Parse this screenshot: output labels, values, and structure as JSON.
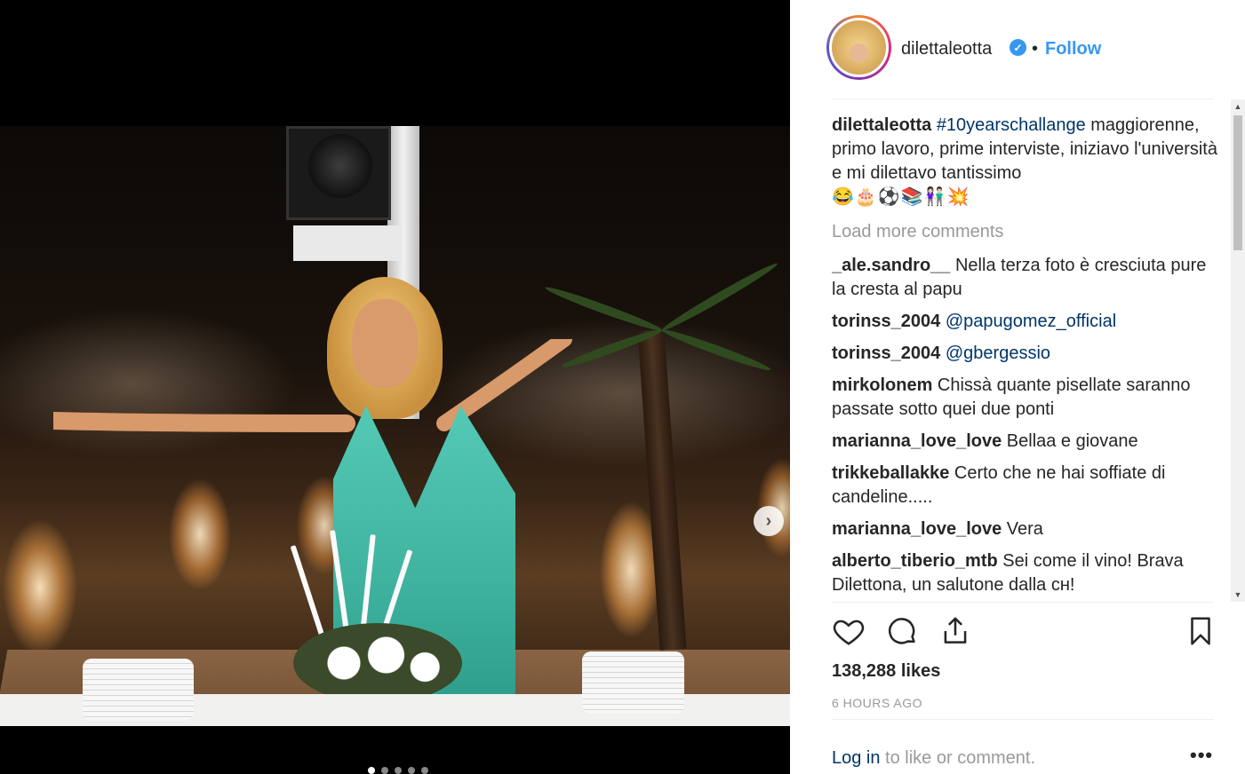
{
  "post": {
    "username": "dilettaleotta",
    "bullet": "•",
    "follow_label": "Follow",
    "caption": {
      "username": "dilettaleotta",
      "hashtag": "#10yearschallange",
      "text": " maggiorenne, primo lavoro, prime interviste, iniziavo l'università e mi dilettavo tantissimo",
      "emojis": "😂🎂⚽📚👫🏻💥"
    },
    "load_more_label": "Load more comments",
    "comments": [
      {
        "user": "_ale.sandro__",
        "mention": "",
        "text": "Nella terza foto è cresciuta pure la cresta al papu"
      },
      {
        "user": "torinss_2004",
        "mention": "@papugomez_official",
        "text": ""
      },
      {
        "user": "torinss_2004",
        "mention": "@gbergessio",
        "text": ""
      },
      {
        "user": "mirkolonem",
        "mention": "",
        "text": "Chissà quante pisellate saranno passate sotto quei due ponti"
      },
      {
        "user": "marianna_love_love",
        "mention": "",
        "text": "Bellaa e giovane"
      },
      {
        "user": "trikkeballakke",
        "mention": "",
        "text": "Certo che ne hai soffiate di candeline....."
      },
      {
        "user": "marianna_love_love",
        "mention": "",
        "text": "Vera"
      },
      {
        "user": "alberto_tiberio_mtb",
        "mention": "",
        "text": "Sei come il vino! Brava Dilettona, un salutone dalla ᴄʜ!"
      }
    ],
    "likes": "138,288 likes",
    "time": "6 HOURS AGO",
    "login_link": "Log in",
    "login_rest": " to like or comment.",
    "more_label": "•••",
    "next_arrow": "›",
    "scroll_up": "▲",
    "scroll_down": "▼"
  },
  "carousel": {
    "count": 5,
    "active": 0
  },
  "colors": {
    "link": "#3897f0",
    "tag": "#003569",
    "muted": "#999999",
    "dress": "#3fb3a0"
  },
  "icons": [
    "heart-icon",
    "comment-icon",
    "share-icon",
    "bookmark-icon",
    "verified-icon",
    "chevron-right-icon"
  ]
}
